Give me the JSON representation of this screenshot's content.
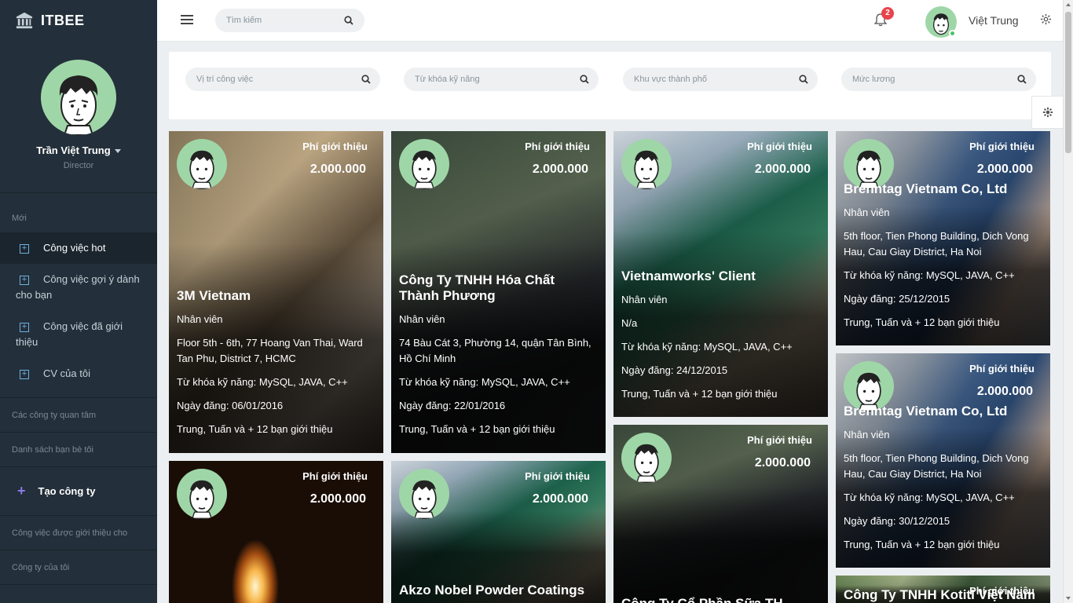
{
  "brand": {
    "name": "ITBEE"
  },
  "profile": {
    "name": "Trần Việt Trung",
    "role": "Director"
  },
  "sidebar": {
    "section_new": "Mới",
    "items": [
      {
        "label": "Công việc hot"
      },
      {
        "label": "Công việc gợi ý dành cho bạn"
      },
      {
        "label": "Công việc đã giới thiệu"
      },
      {
        "label": "CV của tôi"
      }
    ],
    "section_companies": "Các công ty quan tâm",
    "section_friends": "Danh sách bạn bè tôi",
    "create_company": "Tạo công ty",
    "section_referred": "Công việc được giới thiệu cho",
    "section_my_company": "Công ty của tôi"
  },
  "header": {
    "search_placeholder": "Tìm kiếm",
    "notification_count": "2",
    "user_name": "Việt Trung"
  },
  "filters": {
    "position": "Vị trí công việc",
    "skills": "Từ khóa kỹ năng",
    "city": "Khu vực thành phố",
    "salary": "Mức lương"
  },
  "colors": {
    "sidebar_bg": "#232f3a",
    "accent_avatar": "#9fd6a8",
    "badge": "#e8434b"
  },
  "cards": [
    {
      "fee_label": "Phí giới thiệu",
      "fee": "2.000.000",
      "company": "3M Vietnam",
      "position": "Nhân viên",
      "address": "Floor 5th - 6th, 77 Hoang Van Thai, Ward Tan Phu, District 7, HCMC",
      "skills": "Từ khóa kỹ năng: MySQL, JAVA, C++",
      "date": "Ngày đăng: 06/01/2016",
      "referrers": "Trung, Tuấn và + 12 bạn giới thiệu"
    },
    {
      "fee_label": "Phí giới thiệu",
      "fee": "2.000.000",
      "company": "Công Ty TNHH Hóa Chất Thành Phương",
      "position": "Nhân viên",
      "address": "74 Bàu Cát 3, Phường 14, quận Tân Bình, Hồ Chí Minh",
      "skills": "Từ khóa kỹ năng: MySQL, JAVA, C++",
      "date": "Ngày đăng: 22/01/2016",
      "referrers": "Trung, Tuấn và + 12 bạn giới thiệu"
    },
    {
      "fee_label": "Phí giới thiệu",
      "fee": "2.000.000",
      "company": "Vietnamworks' Client",
      "position": "Nhân viên",
      "address": "N/a",
      "skills": "Từ khóa kỹ năng: MySQL, JAVA, C++",
      "date": "Ngày đăng: 24/12/2015",
      "referrers": "Trung, Tuấn và + 12 bạn giới thiệu"
    },
    {
      "fee_label": "Phí giới thiệu",
      "fee": "2.000.000",
      "company": "Brenntag Vietnam Co, Ltd",
      "position": "Nhân viên",
      "address": "5th floor, Tien Phong Building, Dich Vong Hau, Cau Giay District, Ha Noi",
      "skills": "Từ khóa kỹ năng: MySQL, JAVA, C++",
      "date": "Ngày đăng: 25/12/2015",
      "referrers": "Trung, Tuấn và + 12 bạn giới thiệu"
    },
    {
      "fee_label": "Phí giới thiệu",
      "fee": "2.000.000",
      "company": "Brenntag Vietnam Co, Ltd",
      "position": "Nhân viên",
      "address": "5th floor, Tien Phong Building, Dich Vong Hau, Cau Giay District, Ha Noi",
      "skills": "Từ khóa kỹ năng: MySQL, JAVA, C++",
      "date": "Ngày đăng: 30/12/2015",
      "referrers": "Trung, Tuấn và + 12 bạn giới thiệu"
    },
    {
      "fee_label": "Phí giới thiệu",
      "fee": "2.000.000"
    },
    {
      "fee_label": "Phí giới thiệu",
      "fee": "2.000.000",
      "company": "Akzo Nobel Powder Coatings"
    },
    {
      "fee_label": "Phí giới thiệu",
      "fee": "2.000.000",
      "company": "Công Ty Cổ Phần Sữa TH"
    },
    {
      "fee_label": "Phí giới thiệu",
      "company": "Công Ty TNHH Kotiti Việt Nam"
    }
  ]
}
